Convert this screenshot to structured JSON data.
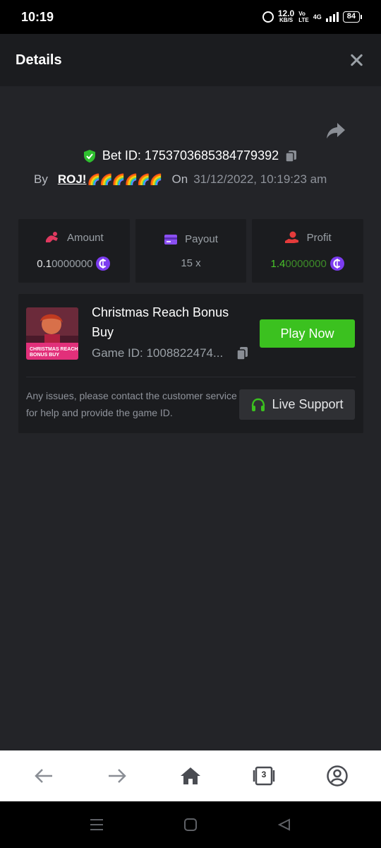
{
  "status_bar": {
    "time": "10:19",
    "speed_value": "12.0",
    "speed_unit": "KB/S",
    "network_top": "Vo",
    "network_bottom": "LTE",
    "network_type": "4G",
    "battery": "84"
  },
  "header": {
    "title": "Details"
  },
  "bet": {
    "id_label": "Bet ID: 1753703685384779392",
    "by_label": "By",
    "user": "ROJ!",
    "user_emoji": "🌈🌈🌈🌈🌈🌈",
    "on_label": "On",
    "date": "31/12/2022, 10:19:23 am"
  },
  "stats": {
    "amount": {
      "label": "Amount",
      "value_main": "0.1",
      "value_rest": "0000000"
    },
    "payout": {
      "label": "Payout",
      "value": "15 x"
    },
    "profit": {
      "label": "Profit",
      "value_main": "1.4",
      "value_rest": "0000000"
    }
  },
  "game": {
    "title": "Christmas Reach Bonus Buy",
    "id": "Game ID: 1008822474...",
    "thumb_caption_1": "CHRISTMAS REACH",
    "thumb_caption_2": "BONUS BUY",
    "play_label": "Play Now",
    "support_text": "Any issues, please contact the customer service for help and provide the game ID.",
    "support_label": "Live Support"
  },
  "browser": {
    "tab_count": "3"
  },
  "colors": {
    "accent_green": "#3bc11f",
    "coin_purple": "#7c3cf0",
    "amount_icon": "#e0395f",
    "payout_icon": "#8b4ff2",
    "profit_icon": "#e53b3b",
    "shield_green": "#2fbf2f"
  },
  "icons": [
    "close-icon",
    "share-icon",
    "shield-icon",
    "copy-icon",
    "coin-icon",
    "headset-icon",
    "back-arrow-icon",
    "forward-arrow-icon",
    "home-icon",
    "tabs-icon",
    "account-icon"
  ]
}
